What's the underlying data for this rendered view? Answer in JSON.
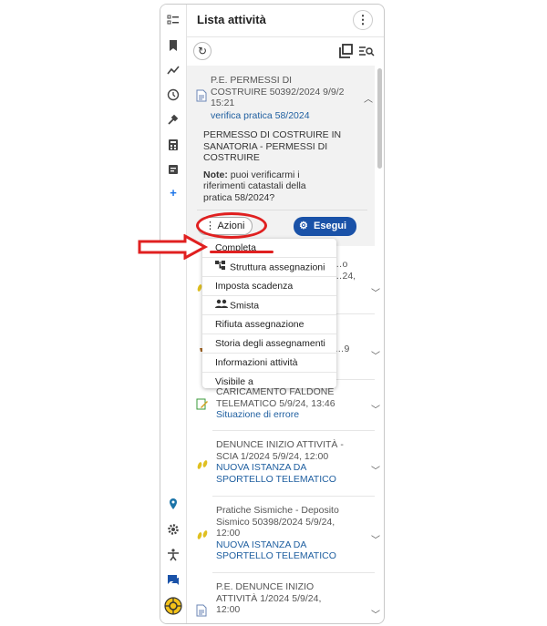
{
  "panel": {
    "title": "Lista attività",
    "menu_icon": "more-vert-icon"
  },
  "rail_icons": [
    "task-list-icon",
    "bookmarks-icon",
    "trend-icon",
    "history-icon",
    "tools-icon",
    "calculator-icon",
    "notes-icon",
    "add-icon",
    "location-icon",
    "settings-icon",
    "accessibility-icon",
    "chat-icon",
    "help-icon"
  ],
  "toolbar": {
    "refresh_icon": "refresh-icon",
    "tool1_icon": "copy-icon",
    "tool2_icon": "filter-list-icon"
  },
  "expanded_task": {
    "title_lines": [
      "P.E. PERMESSI DI",
      "COSTRUIRE  50392/2024  9/9/2",
      "15:21"
    ],
    "subtitle": "verifica pratica 58/2024",
    "desc_lines": [
      "PERMESSO DI COSTRUIRE IN",
      "SANATORIA - PERMESSI DI",
      "COSTRUIRE"
    ],
    "note_label": "Note:",
    "note_lines": [
      "puoi verificarmi i",
      "riferimenti catastali della",
      "pratica 58/2024?"
    ],
    "azioni_label": "Azioni",
    "esegui_label": "Esegui"
  },
  "menu_items": [
    {
      "label": "Completa",
      "icon": ""
    },
    {
      "label": "Struttura assegnazioni",
      "icon": "tree-icon"
    },
    {
      "label": "Imposta scadenza",
      "icon": ""
    },
    {
      "label": "Smista",
      "icon": "people-icon"
    },
    {
      "label": "Rifiuta assegnazione",
      "icon": ""
    },
    {
      "label": "Storia degli assegnamenti",
      "icon": ""
    },
    {
      "label": "Informazioni attività",
      "icon": ""
    },
    {
      "label": "Visibile a",
      "icon": ""
    }
  ],
  "tasks": [
    {
      "title_lines": [
        "…o",
        "…24,"
      ],
      "subtitle": ""
    },
    {
      "title_lines": [
        "…9"
      ],
      "subtitle": ""
    },
    {
      "title_lines": [
        "CARICAMENTO FALDONE",
        "TELEMATICO  5/9/24, 13:46"
      ],
      "subtitle": "Situazione di errore"
    },
    {
      "title_lines": [
        "DENUNCE INIZIO ATTIVITÀ -",
        "SCIA  1/2024  5/9/24, 12:00"
      ],
      "subtitle_lines": [
        "NUOVA ISTANZA DA",
        "SPORTELLO TELEMATICO"
      ]
    },
    {
      "title_lines": [
        "Pratiche Sismiche - Deposito",
        "Sismico  50398/2024  5/9/24,",
        "12:00"
      ],
      "subtitle_lines": [
        "NUOVA ISTANZA DA",
        "SPORTELLO TELEMATICO"
      ]
    },
    {
      "title_lines": [
        "P.E. DENUNCE INIZIO",
        "ATTIVITÀ  1/2024  5/9/24,",
        "12:00"
      ],
      "subtitle": ""
    }
  ],
  "colors": {
    "accent": "#1a52a8",
    "link": "#1f5fa0",
    "annotation_red": "#e02020"
  }
}
